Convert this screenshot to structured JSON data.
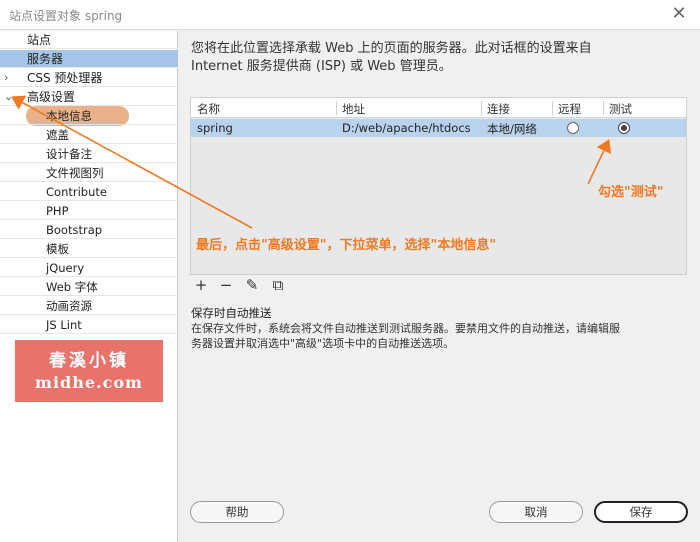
{
  "window": {
    "title": "站点设置对象 spring",
    "close_glyph": "✕"
  },
  "sidebar": {
    "items": [
      {
        "label": "站点",
        "selected": false,
        "chevron": ""
      },
      {
        "label": "服务器",
        "selected": true,
        "chevron": ""
      },
      {
        "label": "CSS 预处理器",
        "selected": false,
        "chevron": "›"
      },
      {
        "label": "高级设置",
        "selected": false,
        "chevron": "⌄"
      },
      {
        "label": "本地信息",
        "selected": false,
        "chevron": ""
      },
      {
        "label": "遮盖",
        "selected": false,
        "chevron": ""
      },
      {
        "label": "设计备注",
        "selected": false,
        "chevron": ""
      },
      {
        "label": "文件视图列",
        "selected": false,
        "chevron": ""
      },
      {
        "label": "Contribute",
        "selected": false,
        "chevron": ""
      },
      {
        "label": "PHP",
        "selected": false,
        "chevron": ""
      },
      {
        "label": "Bootstrap",
        "selected": false,
        "chevron": ""
      },
      {
        "label": "模板",
        "selected": false,
        "chevron": ""
      },
      {
        "label": "jQuery",
        "selected": false,
        "chevron": ""
      },
      {
        "label": "Web 字体",
        "selected": false,
        "chevron": ""
      },
      {
        "label": "动画资源",
        "selected": false,
        "chevron": ""
      },
      {
        "label": "JS Lint",
        "selected": false,
        "chevron": ""
      }
    ]
  },
  "watermark": {
    "line1": "春溪小镇",
    "line2": "midhe.com"
  },
  "main": {
    "intro_line1": "您将在此位置选择承载 Web 上的页面的服务器。此对话框的设置来自",
    "intro_line2": "Internet 服务提供商 (ISP) 或 Web 管理员。",
    "table": {
      "headers": {
        "name": "名称",
        "address": "地址",
        "connection": "连接",
        "remote": "远程",
        "test": "测试"
      },
      "rows": [
        {
          "name": "spring",
          "address": "D:/web/apache/htdocs",
          "connection": "本地/网络",
          "remote": false,
          "test": true
        }
      ]
    },
    "toolbar": {
      "add": "+",
      "remove": "−",
      "edit": "✎",
      "duplicate": "⧉"
    },
    "auto_push_label": "保存时自动推送",
    "auto_push_desc_1": "在保存文件时，系统会将文件自动推送到测试服务器。要禁用文件的自动推送，请编辑服",
    "auto_push_desc_2": "务器设置并取消选中\"高级\"选项卡中的自动推送选项。"
  },
  "buttons": {
    "help": "帮助",
    "cancel": "取消",
    "save": "保存"
  },
  "annotations": {
    "check_test": "勾选\"测试\"",
    "advanced_hint": "最后，点击\"高级设置\"，下拉菜单，选择\"本地信息\""
  },
  "colors": {
    "accent_annotation": "#f07a24",
    "selection": "#a6c5e8",
    "row_selection": "#b9d2ee",
    "highlight_pill": "#e8a97c",
    "watermark_bg": "#e9726b"
  }
}
